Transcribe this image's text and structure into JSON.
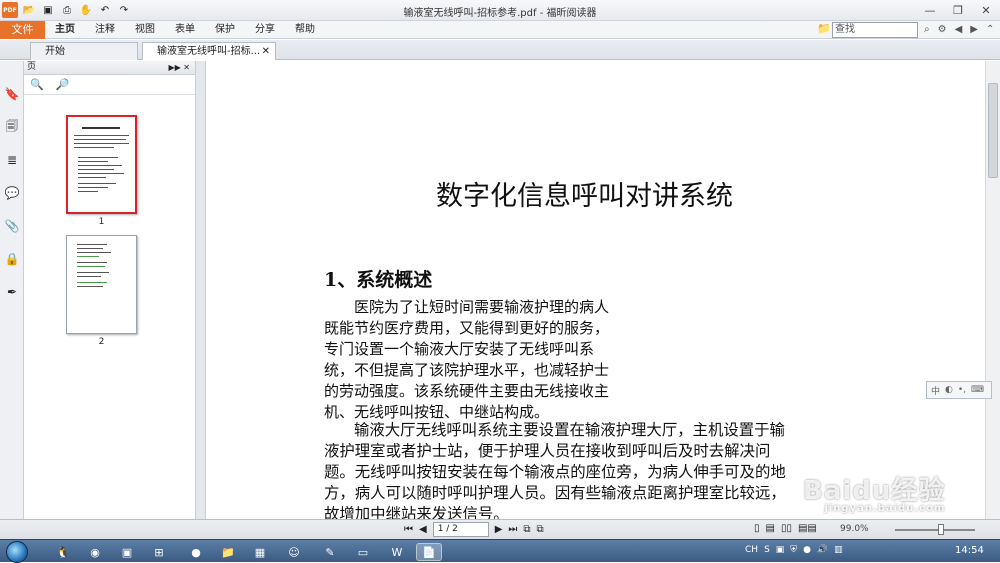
{
  "window": {
    "title": "输液室无线呼叫-招标参考.pdf - 福昕阅读器",
    "app_icon_label": "PDF"
  },
  "menubar": {
    "file_tab": "文件",
    "items": [
      "主页",
      "注释",
      "视图",
      "表单",
      "保护",
      "分享",
      "帮助"
    ],
    "search_placeholder": "查找"
  },
  "tabs": [
    {
      "label": "开始"
    },
    {
      "label": "输液室无线呼叫-招标..."
    }
  ],
  "panel": {
    "title": "页",
    "thumbnails": [
      {
        "number": "1"
      },
      {
        "number": "2"
      }
    ]
  },
  "document": {
    "title": "数字化信息呼叫对讲系统",
    "heading": "1、系统概述",
    "para1": [
      "医院为了让短时间需要输液护理的病人",
      "既能节约医疗费用，又能得到更好的服务，",
      "专门设置一个输液大厅安装了无线呼叫系",
      "统，不但提高了该院护理水平，也减轻护士",
      "的劳动强度。该系统硬件主要由无线接收主",
      "机、无线呼叫按钮、中继站构成。"
    ],
    "para2": [
      "输液大厅无线呼叫系统主要设置在输液护理大厅，主机设置于输",
      "液护理室或者护士站，便于护理人员在接收到呼叫后及时去解决问",
      "题。无线呼叫按钮安装在每个输液点的座位旁，为病人伸手可及的地",
      "方，病人可以随时呼叫护理人员。因有些输液点距离护理室比较远，",
      "故增加中继站来发送信号。"
    ]
  },
  "statusbar": {
    "page_indicator": "1 / 2",
    "zoom": "99.0%"
  },
  "taskbar": {
    "lang": "CH",
    "time": "14:54"
  },
  "watermark": {
    "text": "Baidu经验",
    "sub": "jingyan.baidu.com"
  },
  "colors": {
    "accent": "#e8722a",
    "selection": "#d8232a",
    "taskbar": "#3b5b82"
  }
}
